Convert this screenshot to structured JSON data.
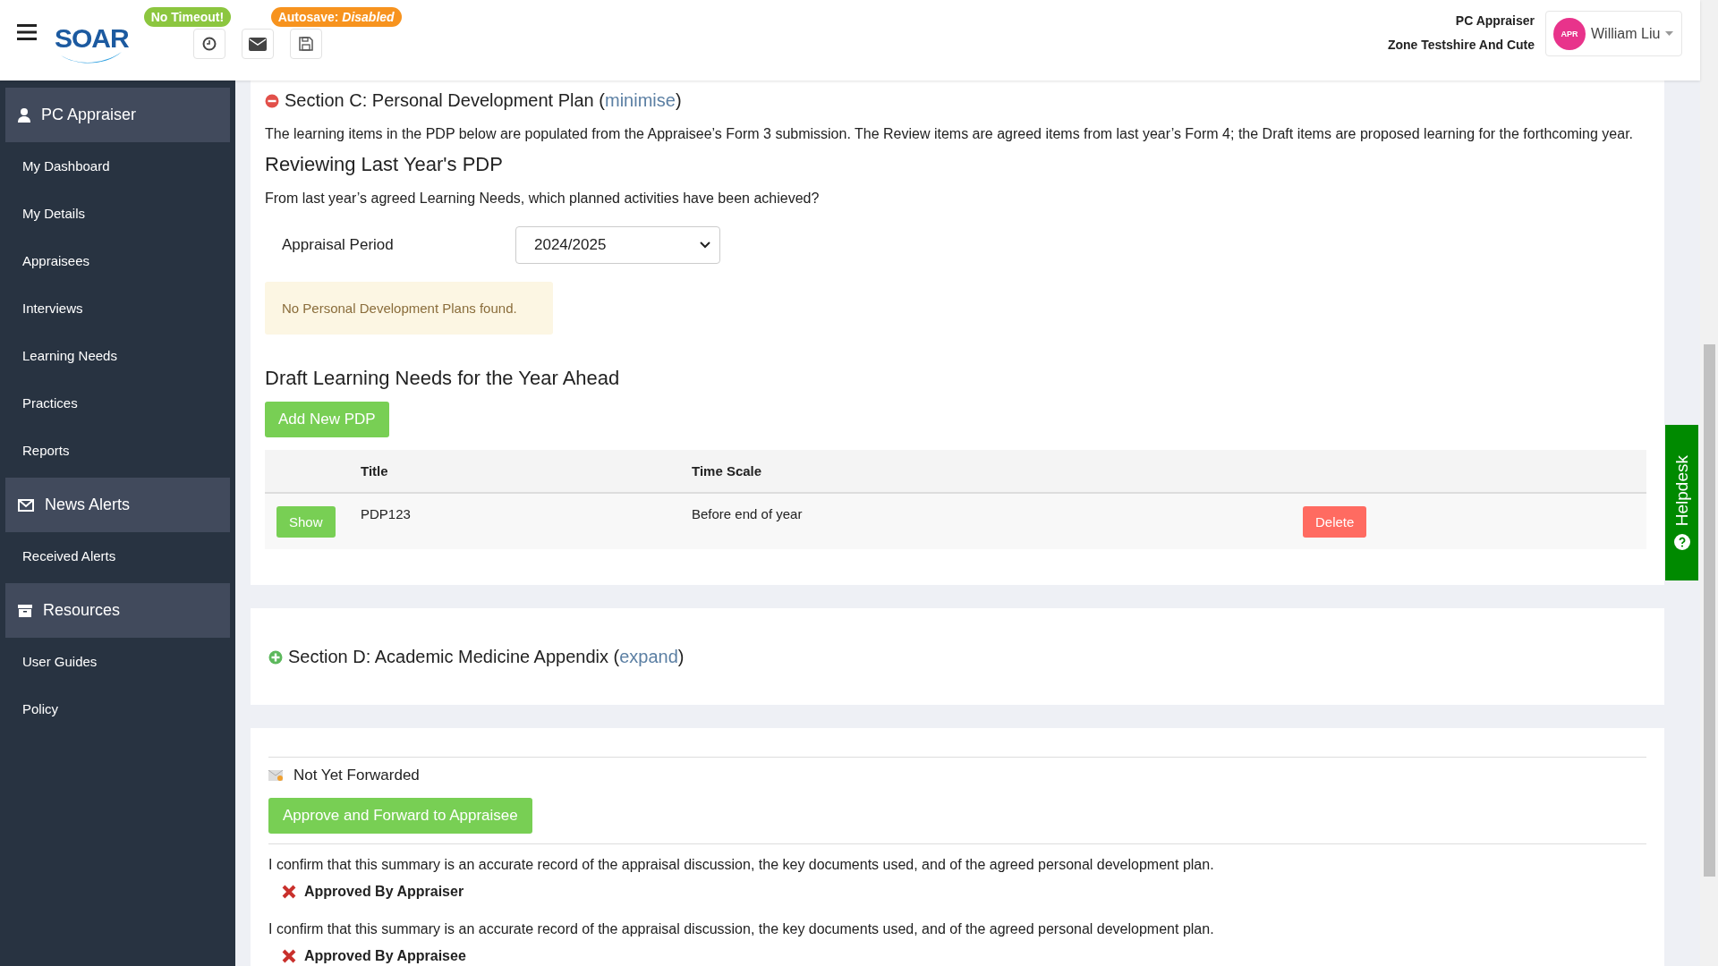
{
  "header": {
    "logo": "SOAR",
    "badges": [
      {
        "text": "No Timeout!",
        "color": "#8cc63f"
      },
      {
        "text": "Autosave: *Disabled*",
        "color": "#f7931e"
      }
    ],
    "tools": [
      {
        "kind": "clock"
      },
      {
        "kind": "mail"
      },
      {
        "kind": "save"
      }
    ],
    "role": "PC Appraiser",
    "organisation": "Zone Testshire And Cute",
    "user": {
      "initials": "APR",
      "name": "William Liu"
    }
  },
  "sidebar": {
    "groups": [
      {
        "title": "PC Appraiser",
        "kind": "user",
        "items": [
          "My Dashboard",
          "My Details",
          "Appraisees",
          "Interviews",
          "Learning Needs",
          "Practices",
          "Reports"
        ]
      },
      {
        "title": "News Alerts",
        "kind": "mail",
        "items": [
          "Received Alerts"
        ]
      },
      {
        "title": "Resources",
        "kind": "archive",
        "items": [
          "User Guides",
          "Policy"
        ]
      }
    ]
  },
  "section_c": {
    "expanded": true,
    "title": "Section C: Personal Development Plan (",
    "toggle": "minimise",
    "toggle_end": ")",
    "intro": "The learning items in the PDP below are populated from the Appraisee’s Form 3 submission. The Review items are agreed items from last year’s Form 4; the Draft items are proposed learning for the forthcoming year.",
    "review_heading": "Reviewing Last Year's PDP",
    "review_question": "From last year’s agreed Learning Needs, which planned activities have been achieved?",
    "period_label": "Appraisal Period",
    "period_value": "2024/2025",
    "empty_message": "No Personal Development Plans found.",
    "draft_heading": "Draft Learning Needs for the Year Ahead",
    "add_button": "Add New PDP",
    "table": {
      "columns": [
        "Title",
        "Time Scale"
      ],
      "rows": [
        {
          "show_button": "Show",
          "title": "PDP123",
          "time_scale": "Before end of year",
          "delete_button": "Delete"
        }
      ]
    }
  },
  "section_d": {
    "expanded": false,
    "title": "Section D: Academic Medicine Appendix (",
    "toggle": "expand",
    "toggle_end": ")"
  },
  "sign_off": {
    "status": "Not Yet Forwarded",
    "forward_button": "Approve and Forward to Appraisee",
    "confirmations": [
      {
        "text": "I confirm that this summary is an accurate record of the appraisal discussion, the key documents used, and of the agreed personal development plan.",
        "label": "Approved By Appraiser",
        "approved": false
      },
      {
        "text": "I confirm that this summary is an accurate record of the appraisal discussion, the key documents used, and of the agreed personal development plan.",
        "label": "Approved By Appraisee",
        "approved": false
      }
    ]
  },
  "helpdesk": "Helpdesk"
}
